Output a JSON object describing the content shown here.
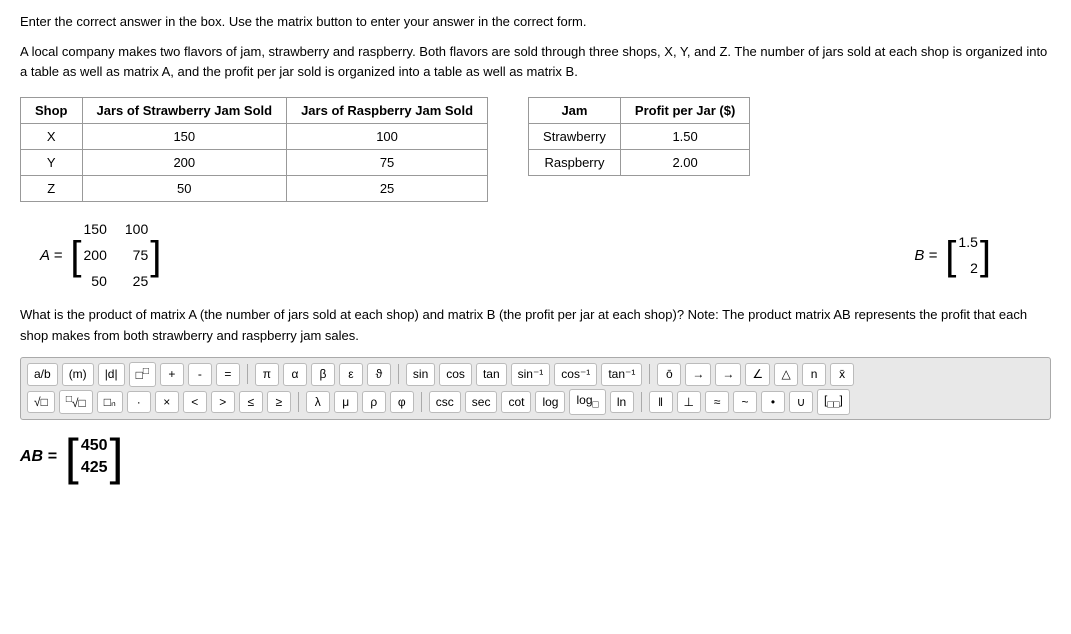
{
  "intro": {
    "line1": "Enter the correct answer in the box. Use the matrix button to enter your answer in the correct form.",
    "line2": "A local company makes two flavors of jam, strawberry and raspberry. Both flavors are sold through three shops, X, Y, and Z. The number of jars sold at each shop is organized into a table as well as matrix A, and the profit per jar sold is organized into a table as well as matrix B."
  },
  "tableA": {
    "headers": [
      "Shop",
      "Jars of Strawberry Jam Sold",
      "Jars of Raspberry Jam Sold"
    ],
    "rows": [
      [
        "X",
        "150",
        "100"
      ],
      [
        "Y",
        "200",
        "75"
      ],
      [
        "Z",
        "50",
        "25"
      ]
    ]
  },
  "tableB": {
    "headers": [
      "Jam",
      "Profit per Jar ($)"
    ],
    "rows": [
      [
        "Strawberry",
        "1.50"
      ],
      [
        "Raspberry",
        "2.00"
      ]
    ]
  },
  "matrixA": {
    "label": "A =",
    "values": [
      [
        "150",
        "100"
      ],
      [
        "200",
        "75"
      ],
      [
        "50",
        "25"
      ]
    ]
  },
  "matrixB": {
    "label": "B =",
    "values": [
      [
        "1.5"
      ],
      [
        "2"
      ]
    ]
  },
  "questionText": "What is the product of matrix A (the number of jars sold at each shop) and matrix B (the profit per jar at each shop)? Note: The product matrix AB represents the profit that each shop makes from both strawberry and raspberry jam sales.",
  "toolbar": {
    "row1": [
      "a/b",
      "(m)",
      "|d|",
      "□^□",
      "+",
      "-",
      "=",
      "|",
      "π",
      "α",
      "β",
      "ε",
      "ϑ",
      "sin",
      "cos",
      "tan",
      "sin⁻¹",
      "cos⁻¹",
      "tan⁻¹",
      "ō",
      "→",
      "→",
      "∠",
      "△",
      "n",
      "x̄"
    ],
    "row2": [
      "√□",
      "√□",
      "□ₙ",
      "·",
      "×",
      "<",
      ">",
      "≤",
      "≥",
      "λ",
      "μ",
      "ρ",
      "φ",
      "csc",
      "sec",
      "cot",
      "log",
      "log□",
      "ln",
      "‖",
      "⊥",
      "≈",
      "~",
      "•",
      "∪",
      "[□□]"
    ]
  },
  "answer": {
    "label": "AB =",
    "values": [
      "450",
      "425"
    ]
  },
  "colors": {
    "background": "#ffffff",
    "border": "#999999",
    "toolbar_bg": "#e8e8e8"
  }
}
